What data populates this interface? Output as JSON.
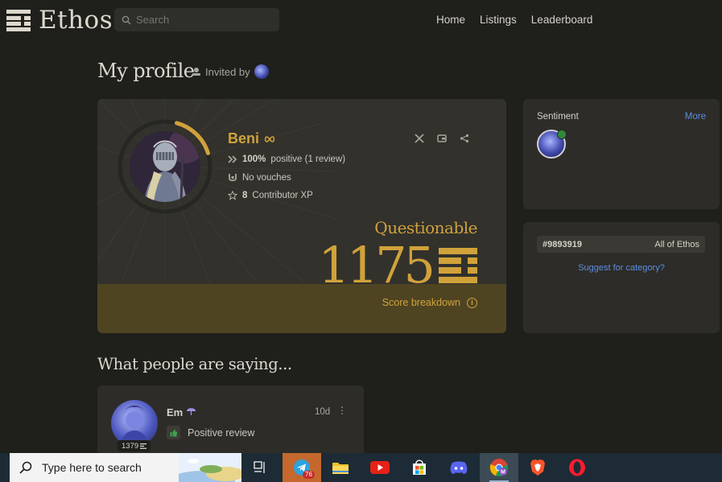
{
  "app": {
    "logo_text": "Ethos",
    "search_placeholder": "Search",
    "nav": [
      "Home",
      "Listings",
      "Leaderboard"
    ]
  },
  "page": {
    "title": "My profile",
    "invited_label": "Invited by"
  },
  "profile": {
    "name": "Beni",
    "stats": {
      "review_pct": "100%",
      "review_text": "positive (1 review)",
      "vouches": "No vouches",
      "xp_value": "8",
      "xp_text": "Contributor XP"
    },
    "score_label": "Questionable",
    "score_value": "1175",
    "breakdown_label": "Score breakdown",
    "score_ring_fraction": 0.16,
    "accent_color": "#d1a23a"
  },
  "sentiment": {
    "title": "Sentiment",
    "more_label": "More"
  },
  "category": {
    "rank": "#9893919",
    "scope": "All of Ethos",
    "suggest_label": "Suggest for category?"
  },
  "reviews": {
    "section_title": "What people are saying...",
    "items": [
      {
        "name": "Em",
        "score": "1379",
        "time": "10d",
        "type": "Positive review"
      }
    ]
  },
  "taskbar": {
    "search_placeholder": "Type here to search",
    "telegram_badge": "76",
    "apps": [
      "task-view",
      "telegram",
      "file-explorer",
      "youtube",
      "microsoft-store",
      "discord",
      "chrome",
      "brave",
      "opera"
    ]
  }
}
